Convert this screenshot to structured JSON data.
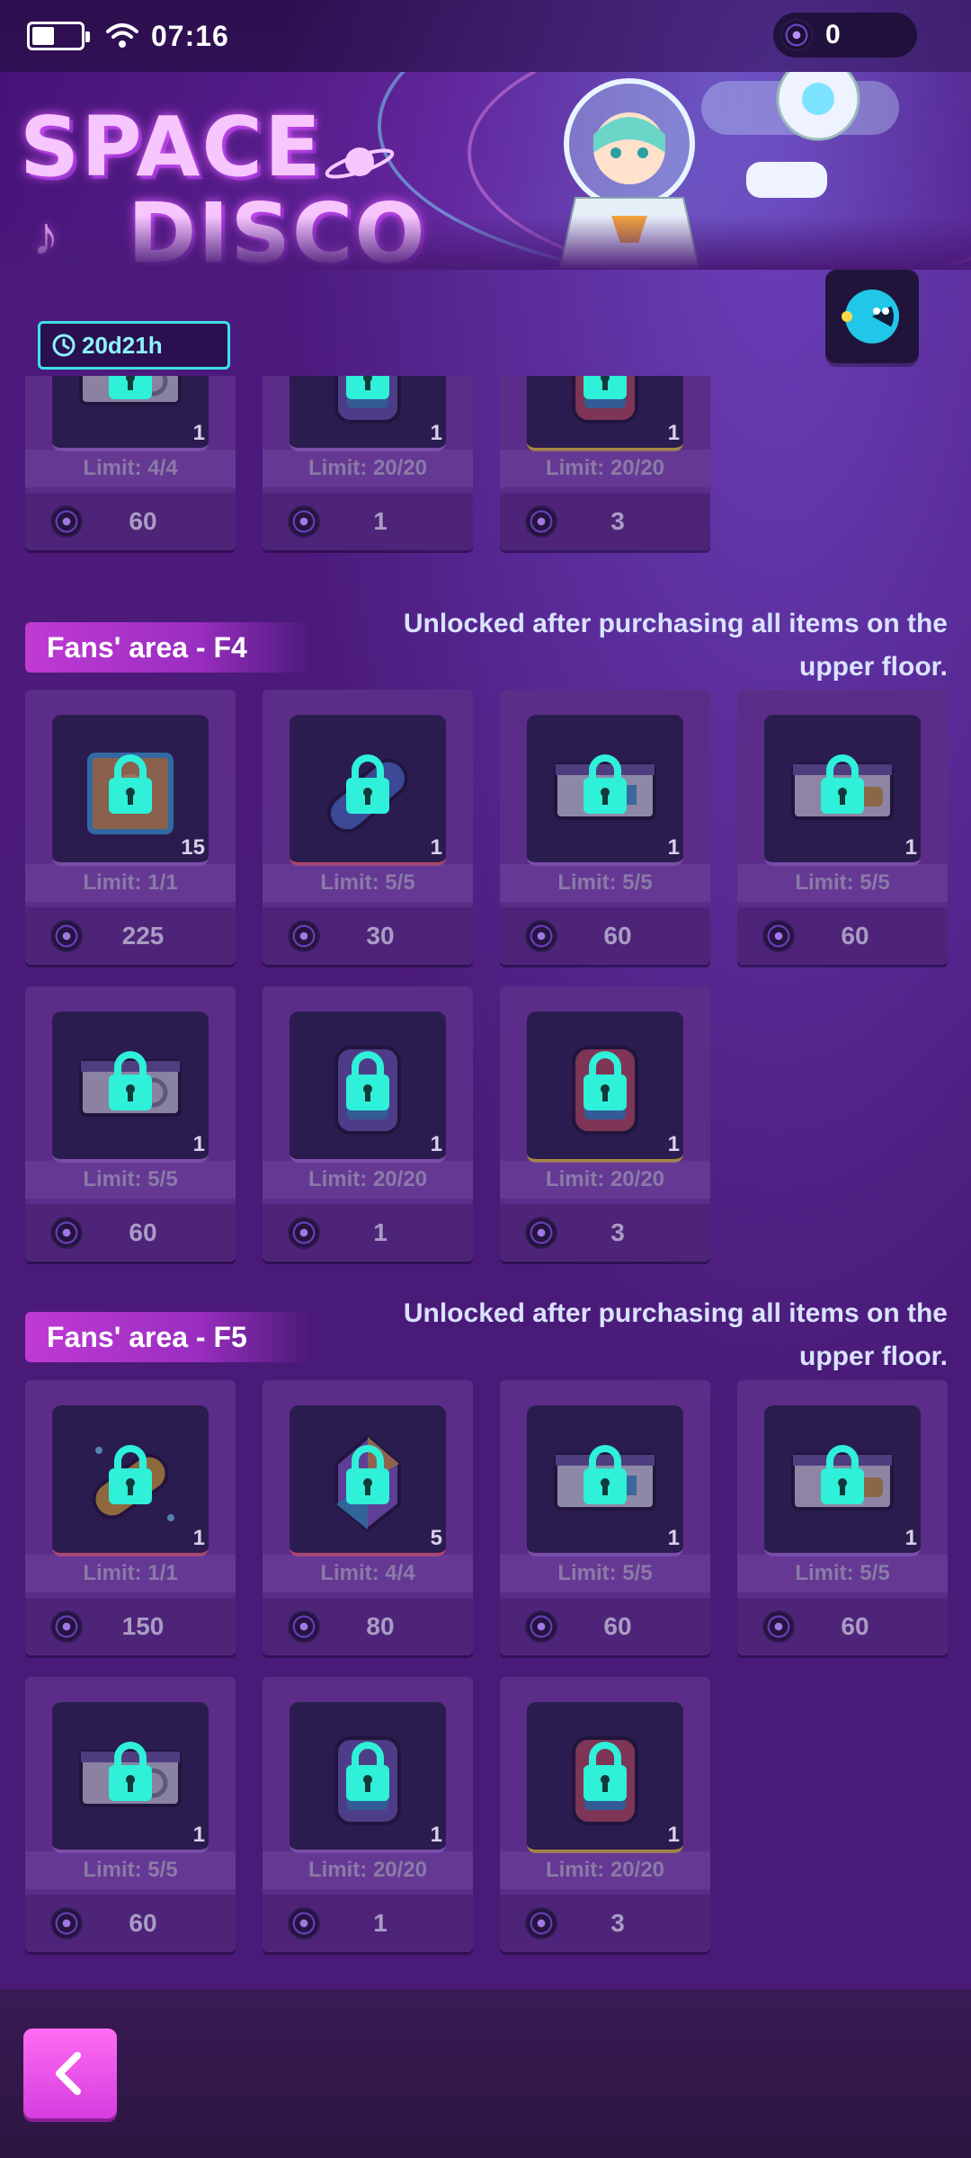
{
  "status_bar": {
    "time": "07:16",
    "currency_value": "0"
  },
  "banner": {
    "title_line1": "SPACE",
    "title_line2": "DISCO",
    "timer": "20d21h"
  },
  "top_partial_items": [
    {
      "limit": "Limit: 4/4",
      "price": "60",
      "qty": "1",
      "art": "ticket"
    },
    {
      "limit": "Limit: 20/20",
      "price": "1",
      "qty": "1",
      "art": "backpack"
    },
    {
      "limit": "Limit: 20/20",
      "price": "3",
      "qty": "1",
      "art": "backpack-red"
    }
  ],
  "sections": [
    {
      "title": "Fans' area - F4",
      "note": "Unlocked after purchasing all items on the upper floor.",
      "items": [
        {
          "limit": "Limit: 1/1",
          "price": "225",
          "qty": "15",
          "art": "frame"
        },
        {
          "limit": "Limit: 5/5",
          "price": "30",
          "qty": "1",
          "art": "capsule"
        },
        {
          "limit": "Limit: 5/5",
          "price": "60",
          "qty": "1",
          "art": "ticket-blue"
        },
        {
          "limit": "Limit: 5/5",
          "price": "60",
          "qty": "1",
          "art": "ticket-gold"
        },
        {
          "limit": "Limit: 5/5",
          "price": "60",
          "qty": "1",
          "art": "ticket"
        },
        {
          "limit": "Limit: 20/20",
          "price": "1",
          "qty": "1",
          "art": "backpack"
        },
        {
          "limit": "Limit: 20/20",
          "price": "3",
          "qty": "1",
          "art": "backpack-red"
        }
      ]
    },
    {
      "title": "Fans' area - F5",
      "note": "Unlocked after purchasing all items on the upper floor.",
      "items": [
        {
          "limit": "Limit: 1/1",
          "price": "150",
          "qty": "1",
          "art": "pill"
        },
        {
          "limit": "Limit: 4/4",
          "price": "80",
          "qty": "5",
          "art": "crystal"
        },
        {
          "limit": "Limit: 5/5",
          "price": "60",
          "qty": "1",
          "art": "ticket-blue"
        },
        {
          "limit": "Limit: 5/5",
          "price": "60",
          "qty": "1",
          "art": "ticket-gold"
        },
        {
          "limit": "Limit: 5/5",
          "price": "60",
          "qty": "1",
          "art": "ticket"
        },
        {
          "limit": "Limit: 20/20",
          "price": "1",
          "qty": "1",
          "art": "backpack"
        },
        {
          "limit": "Limit: 20/20",
          "price": "3",
          "qty": "1",
          "art": "backpack-red"
        }
      ]
    }
  ],
  "colors": {
    "lock": "#2ff0d8",
    "accent": "#d63de0",
    "background": "#4a1a78"
  }
}
